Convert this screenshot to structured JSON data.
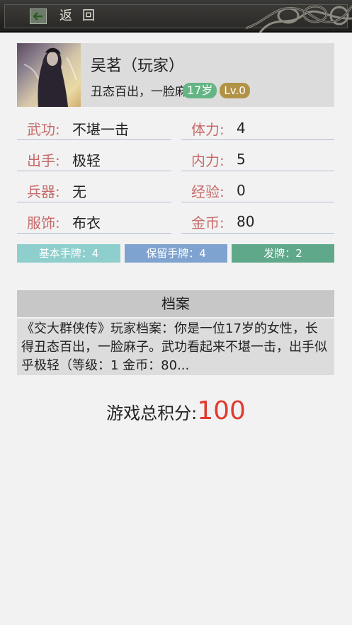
{
  "header": {
    "back_label": "返回"
  },
  "profile": {
    "name": "吴茗（玩家）",
    "desc": "丑态百出，一脸麻",
    "age": "17岁",
    "level": "Lv.0"
  },
  "stats": [
    {
      "key": "武功:",
      "value": "不堪一击"
    },
    {
      "key": "体力:",
      "value": "4"
    },
    {
      "key": "出手:",
      "value": "极轻"
    },
    {
      "key": "内力:",
      "value": "5"
    },
    {
      "key": "兵器:",
      "value": "无"
    },
    {
      "key": "经验:",
      "value": "0"
    },
    {
      "key": "服饰:",
      "value": "布衣"
    },
    {
      "key": "金币:",
      "value": "80"
    }
  ],
  "cards": {
    "basic": "基本手牌：4",
    "reserved": "保留手牌：4",
    "deal": "发牌：2"
  },
  "colors": {
    "basic": "#8ecfce",
    "reserved": "#7fa3d0",
    "deal": "#5fa88a",
    "accent": "#e03a2e"
  },
  "archive": {
    "title": "档案",
    "text": "《交大群侠传》玩家档案：你是一位17岁的女性，长得丑态百出，一脸麻子。武功看起来不堪一击，出手似乎极轻（等级：1 金币：80..."
  },
  "score": {
    "label": "游戏总积分:",
    "value": "100"
  }
}
